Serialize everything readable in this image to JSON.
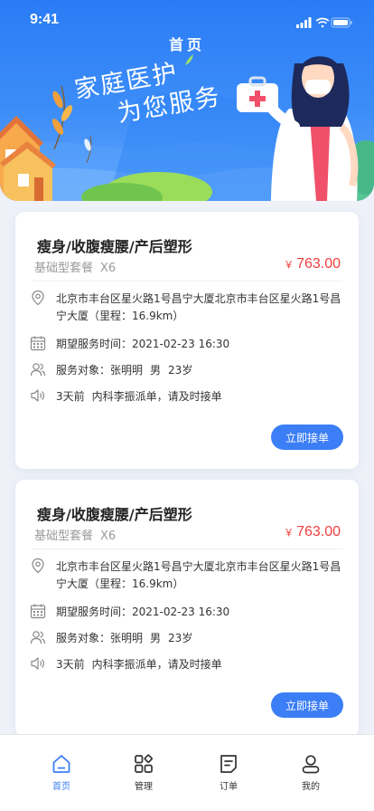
{
  "status_bar": {
    "time": "9:41"
  },
  "header": {
    "title": "首页",
    "slogan_line1": "家庭医护",
    "slogan_line2": "为您服务"
  },
  "colors": {
    "primary": "#3b7ef6",
    "price": "#f03e3e",
    "hero_top": "#2a7cf6"
  },
  "orders": [
    {
      "title": "瘦身/收腹瘦腰/产后塑形",
      "package": "基础型套餐",
      "quantity": "X6",
      "currency": "￥",
      "price": "763.00",
      "address": "北京市丰台区星火路1号昌宁大厦北京市丰台区星火路1号昌",
      "address_cont": "宁大厦（里程：16.9km）",
      "service_time_label": "期望服务时间：",
      "service_time": "2021-02-23  16:30",
      "target_label": "服务对象：",
      "target_name": "张明明",
      "target_gender": "男",
      "target_age": "23岁",
      "notice_time": "3天前",
      "notice_text": "内科李振派单，请及时接单",
      "accept_label": "立即接单"
    },
    {
      "title": "瘦身/收腹瘦腰/产后塑形",
      "package": "基础型套餐",
      "quantity": "X6",
      "currency": "￥",
      "price": "763.00",
      "address": "北京市丰台区星火路1号昌宁大厦北京市丰台区星火路1号昌",
      "address_cont": "宁大厦（里程：16.9km）",
      "service_time_label": "期望服务时间：",
      "service_time": "2021-02-23  16:30",
      "target_label": "服务对象：",
      "target_name": "张明明",
      "target_gender": "男",
      "target_age": "23岁",
      "notice_time": "3天前",
      "notice_text": "内科李振派单，请及时接单",
      "accept_label": "立即接单"
    }
  ],
  "tabbar": {
    "items": [
      {
        "label": "首页",
        "icon": "home-icon",
        "active": true
      },
      {
        "label": "管理",
        "icon": "grid-icon",
        "active": false
      },
      {
        "label": "订单",
        "icon": "order-icon",
        "active": false
      },
      {
        "label": "我的",
        "icon": "user-icon",
        "active": false
      }
    ]
  }
}
